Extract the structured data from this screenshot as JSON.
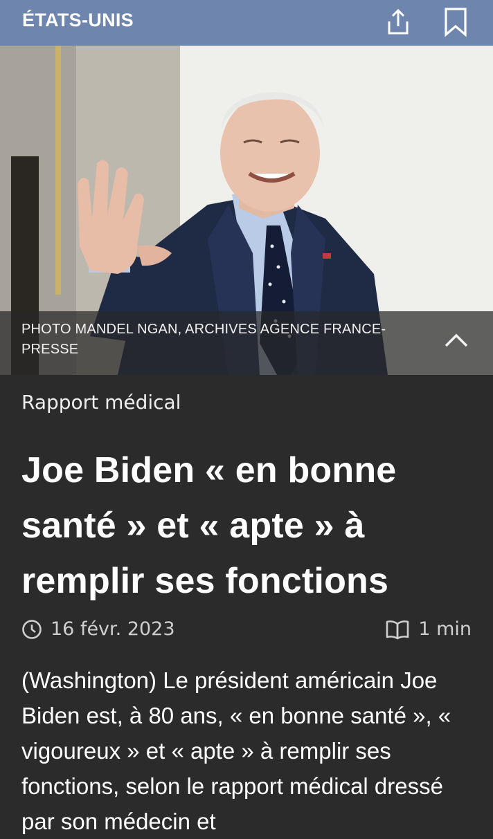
{
  "header": {
    "section": "ÉTATS-UNIS",
    "share_icon": "share-icon",
    "bookmark_icon": "bookmark-icon"
  },
  "hero": {
    "caption": "PHOTO MANDEL NGAN, ARCHIVES AGENCE FRANCE-PRESSE",
    "toggle_icon": "chevron-up-icon"
  },
  "article": {
    "kicker": "Rapport médical",
    "title": "Joe Biden « en bonne santé » et « apte » à remplir ses fonctions",
    "date": "16 févr. 2023",
    "read_time": "1 min",
    "lede": "(Washington) Le président américain Joe Biden est, à 80 ans, « en bonne santé », « vigoureux » et « apte » à remplir ses fonctions, selon le rapport médical dressé par son médecin et"
  },
  "colors": {
    "topbar": "#6e86ad",
    "background": "#2b2b2b",
    "text": "#ffffff",
    "meta": "#cfcfcf"
  }
}
